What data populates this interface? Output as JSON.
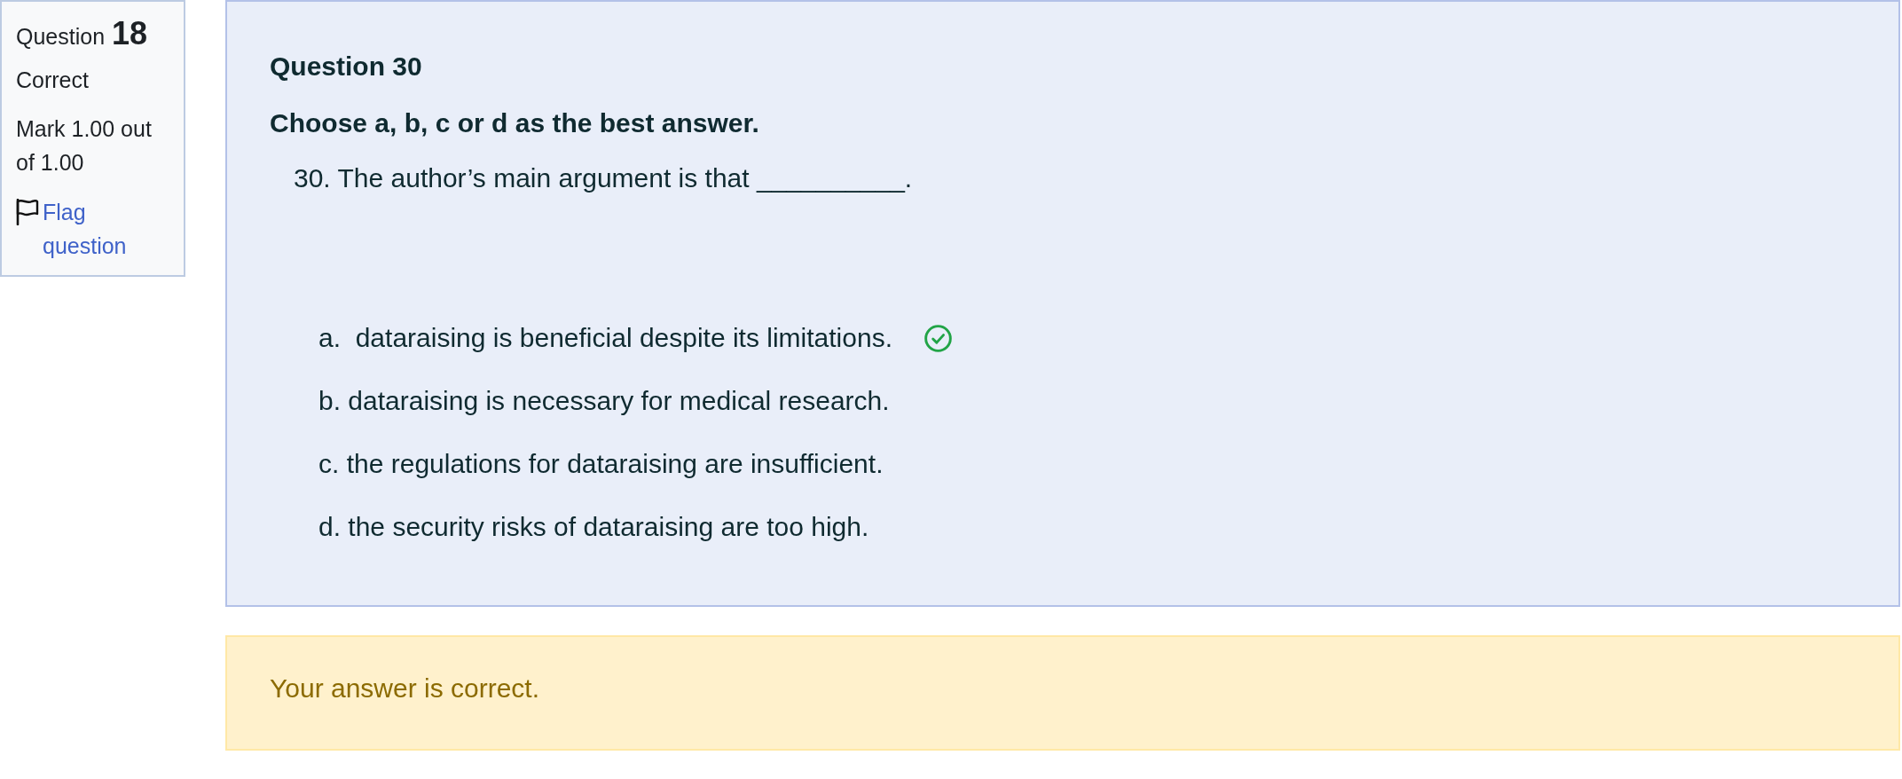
{
  "info": {
    "label": "Question",
    "number": "18",
    "state": "Correct",
    "mark": "Mark 1.00 out of 1.00",
    "flag": {
      "label": "Flag question",
      "flagged": false
    }
  },
  "question": {
    "title": "Question 30",
    "instruction": "Choose a, b, c or d as the best answer.",
    "prompt": "30. The author’s main argument is that __________.",
    "options": [
      {
        "text": "a.  dataraising is beneficial despite its limitations.",
        "correct": true
      },
      {
        "text": "b. dataraising is necessary for medical research.",
        "correct": false
      },
      {
        "text": "c. the regulations for dataraising are insufficient.",
        "correct": false
      },
      {
        "text": "d. the security risks of dataraising are too high.",
        "correct": false
      }
    ]
  },
  "feedback": {
    "text": "Your answer is correct."
  }
}
